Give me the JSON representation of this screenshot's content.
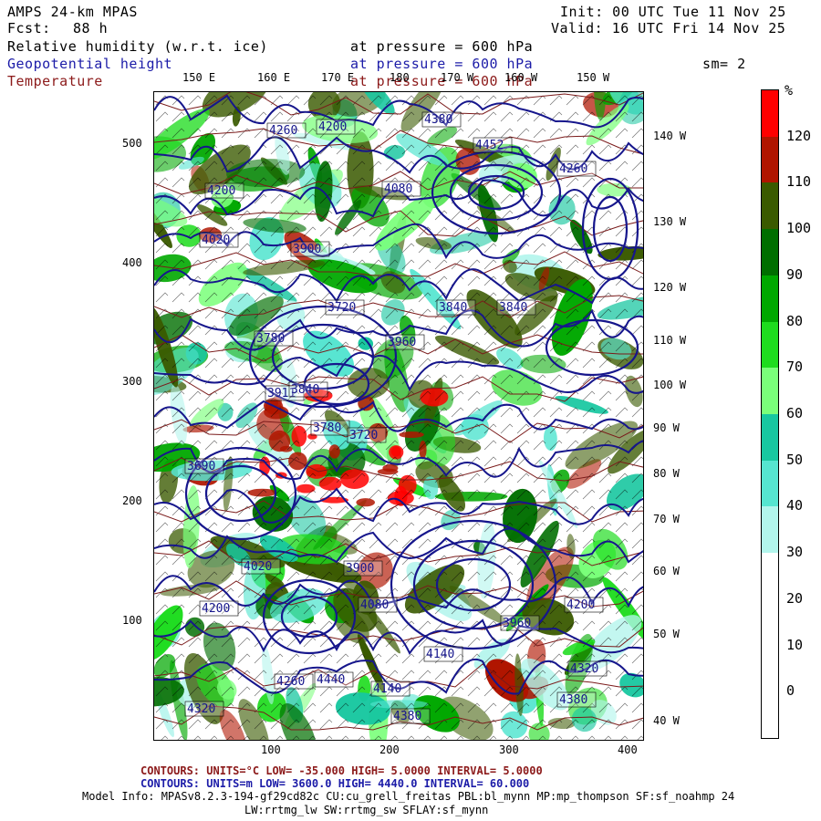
{
  "header": {
    "model": "AMPS 24-km MPAS",
    "fcst_label": "Fcst:",
    "fcst_hours": "88 h",
    "init": "Init: 00 UTC Tue 11 Nov 25",
    "valid": "Valid: 16 UTC Fri 14 Nov 25",
    "field1": "Relative humidity (w.r.t. ice)",
    "field2": "Geopotential height",
    "field3": "Temperature",
    "pressure1": "at pressure =  600 hPa",
    "pressure2": "at pressure =  600 hPa",
    "pressure3": "at pressure =  600 hPa",
    "smoothing": "sm= 2"
  },
  "axes": {
    "x_ticks": [
      "100",
      "200",
      "300",
      "400"
    ],
    "y_ticks": [
      "100",
      "200",
      "300",
      "400",
      "500"
    ],
    "top_lon": [
      "150 E",
      "160 E",
      "170 E",
      "180",
      "170 W",
      "160 W",
      "150 W"
    ],
    "right_lon": [
      "140 W",
      "130 W",
      "120 W",
      "110 W",
      "100 W",
      "90 W",
      "80 W",
      "70 W",
      "60 W",
      "50 W",
      "40 W"
    ]
  },
  "colorbar": {
    "unit": "%",
    "labels": [
      "120",
      "110",
      "100",
      "90",
      "80",
      "70",
      "60",
      "50",
      "40",
      "30",
      "20",
      "10",
      "0"
    ],
    "colors": [
      "#ff0000",
      "#b01500",
      "#3a5a00",
      "#006e00",
      "#00a800",
      "#1edc1e",
      "#7aff7a",
      "#18c7a0",
      "#56e5d0",
      "#b2f5ec",
      "#ffffff",
      "#ffffff",
      "#ffffff",
      "#ffffff"
    ]
  },
  "height_labels": [
    "4380",
    "4260",
    "4200",
    "4452",
    "4260",
    "4200",
    "4080",
    "4020",
    "3900",
    "3840",
    "3780",
    "3720",
    "3960",
    "3840",
    "3911",
    "3840",
    "3780",
    "3720",
    "3690",
    "3900",
    "4020",
    "4200",
    "4080",
    "4140",
    "4200",
    "3960",
    "4320",
    "4380",
    "4440",
    "4380",
    "4320",
    "4260",
    "4140"
  ],
  "footer": {
    "line1": "CONTOURS:  UNITS=°C  LOW= -35.000      HIGH=  5.0000       INTERVAL=   5.0000",
    "line2": "CONTOURS:  UNITS=m  LOW=  3600.0       HIGH=  4440.0       INTERVAL=   60.000",
    "model_info": "Model Info: MPASv8.2.3-194-gf29cd82c CU:cu_grell_freitas PBL:bl_mynn MP:mp_thompson SF:sf_noahmp 24",
    "model_info2": "LW:rrtmg_lw SW:rrtmg_sw SFLAY:sf_mynn"
  }
}
